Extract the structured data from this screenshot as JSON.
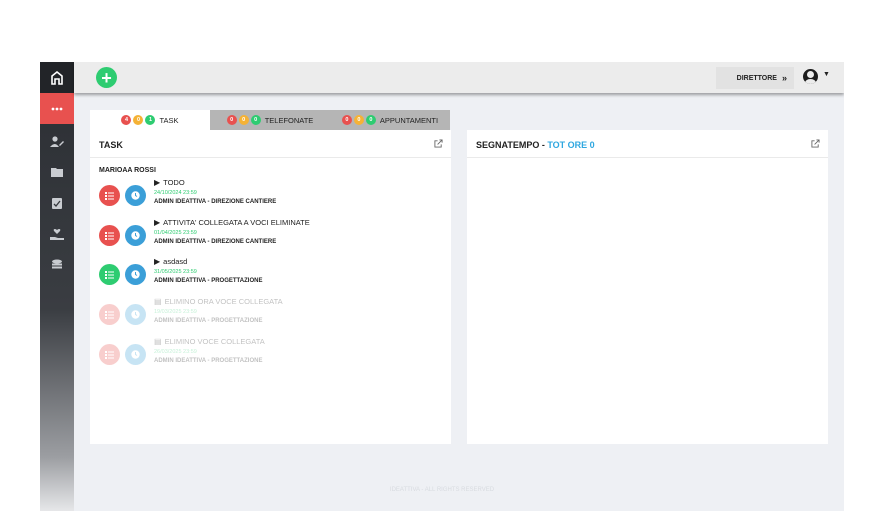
{
  "header": {
    "add_label": "+",
    "role_label": "DIRETTORE",
    "role_chevron": "»"
  },
  "sidebar": {
    "items": [
      {
        "icon": "dots-icon"
      },
      {
        "icon": "user-edit-icon"
      },
      {
        "icon": "folder-icon"
      },
      {
        "icon": "clipboard-check-icon"
      },
      {
        "icon": "hand-heart-icon"
      },
      {
        "icon": "coins-icon"
      }
    ]
  },
  "tabs": [
    {
      "label": "TASK",
      "counts": [
        "4",
        "0",
        "1"
      ]
    },
    {
      "label": "TELEFONATE",
      "counts": [
        "0",
        "0",
        "0"
      ]
    },
    {
      "label": "APPUNTAMENTI",
      "counts": [
        "0",
        "0",
        "0"
      ]
    }
  ],
  "task_panel": {
    "title": "TASK",
    "person": "MARIOAA ROSSI",
    "tasks": [
      {
        "title": "TODO",
        "date": "24/10/2024 23:59",
        "admin": "ADMIN IDEATTIVA - DIREZIONE CANTIERE",
        "status": "red"
      },
      {
        "title": "ATTIVITA' COLLEGATA A VOCI ELIMINATE",
        "date": "01/04/2025 23:59",
        "admin": "ADMIN IDEATTIVA - DIREZIONE CANTIERE",
        "status": "red"
      },
      {
        "title": "asdasd",
        "date": "31/05/2025 23:59",
        "admin": "ADMIN IDEATTIVA - PROGETTAZIONE",
        "status": "green"
      },
      {
        "title": "ELIMINO ORA VOCE COLLEGATA",
        "date": "19/03/2025 23:59",
        "admin": "ADMIN IDEATTIVA - PROGETTAZIONE",
        "status": "red"
      },
      {
        "title": "ELIMINO VOCE COLLEGATA",
        "date": "26/03/2025 23:59",
        "admin": "ADMIN IDEATTIVA - PROGETTAZIONE",
        "status": "red"
      }
    ]
  },
  "time_panel": {
    "title": "SEGNATEMPO - ",
    "title_accent": "TOT ORE 0"
  },
  "footer": "IDEATTIVA - ALL RIGHTS RESERVED"
}
